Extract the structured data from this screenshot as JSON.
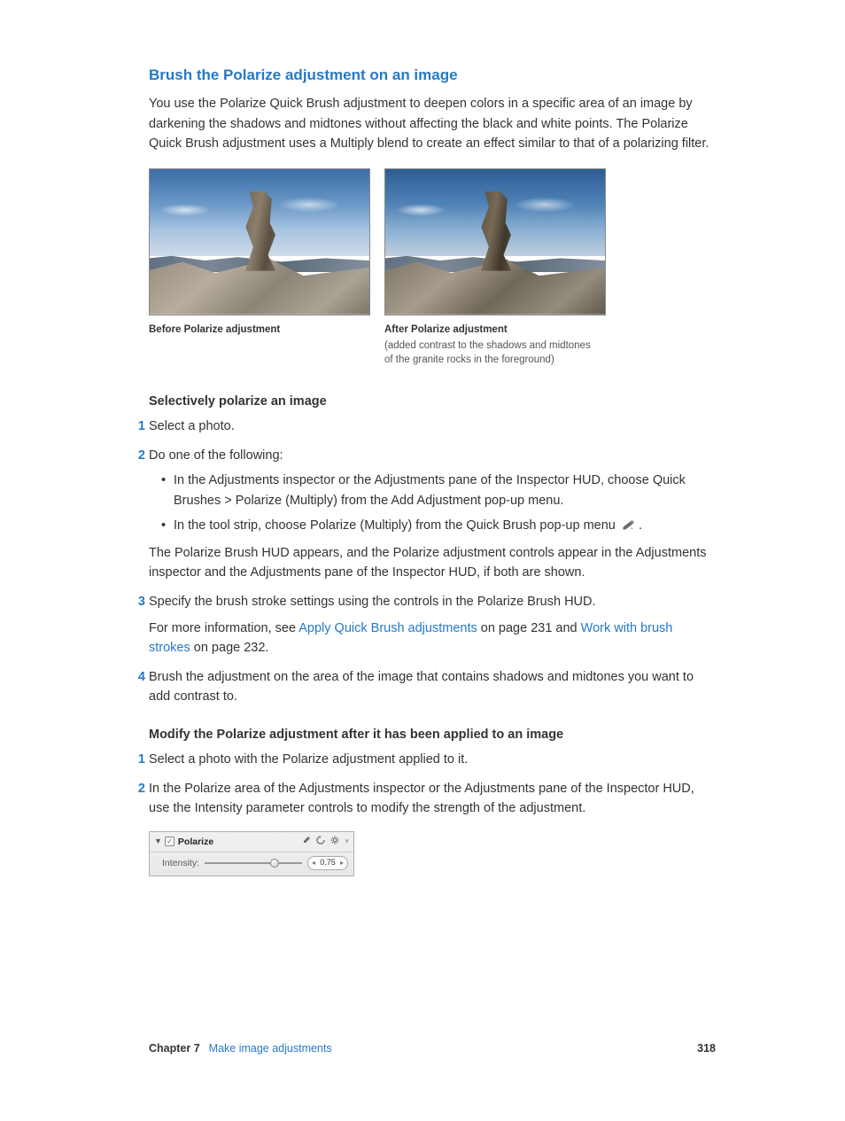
{
  "heading": "Brush the Polarize adjustment on an image",
  "intro": "You use the Polarize Quick Brush adjustment to deepen colors in a specific area of an image by darkening the shadows and midtones without affecting the black and white points. The Polarize Quick Brush adjustment uses a Multiply blend to create an effect similar to that of a polarizing filter.",
  "figures": {
    "before": {
      "caption": "Before Polarize adjustment"
    },
    "after": {
      "caption": "After Polarize adjustment",
      "subcaption": "(added contrast to the shadows and midtones of the granite rocks in the foreground)"
    }
  },
  "task1": {
    "title": "Selectively polarize an image",
    "steps": {
      "s1": "Select a photo.",
      "s2": "Do one of the following:",
      "s2_bullets": {
        "b1": "In the Adjustments inspector or the Adjustments pane of the Inspector HUD, choose Quick Brushes > Polarize (Multiply) from the Add Adjustment pop-up menu.",
        "b2_pre": "In the tool strip, choose Polarize (Multiply) from the Quick Brush pop-up menu ",
        "b2_post": "."
      },
      "s2_after": "The Polarize Brush HUD appears, and the Polarize adjustment controls appear in the Adjustments inspector and the Adjustments pane of the Inspector HUD, if both are shown.",
      "s3": "Specify the brush stroke settings using the controls in the Polarize Brush HUD.",
      "s3_more_pre": "For more information, see ",
      "s3_link1": "Apply Quick Brush adjustments",
      "s3_mid": " on page 231 and ",
      "s3_link2": "Work with brush strokes",
      "s3_post": " on page 232.",
      "s4": "Brush the adjustment on the area of the image that contains shadows and midtones you want to add contrast to."
    }
  },
  "task2": {
    "title": "Modify the Polarize adjustment after it has been applied to an image",
    "steps": {
      "s1": "Select a photo with the Polarize adjustment applied to it.",
      "s2": "In the Polarize area of the Adjustments inspector or the Adjustments pane of the Inspector HUD, use the Intensity parameter controls to modify the strength of the adjustment."
    }
  },
  "panel": {
    "title": "Polarize",
    "param_label": "Intensity:",
    "value": "0.75",
    "slider_position_pct": 72
  },
  "footer": {
    "chapter_label": "Chapter 7",
    "chapter_title": "Make image adjustments",
    "page": "318"
  },
  "nums": {
    "n1": "1",
    "n2": "2",
    "n3": "3",
    "n4": "4"
  }
}
